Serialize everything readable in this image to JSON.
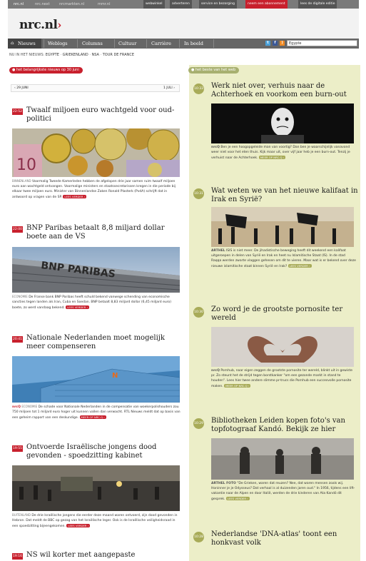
{
  "topbar": {
    "links": [
      "nrc.nl",
      "nrc.next",
      "nrcmarkten.nl",
      "mmr.nl"
    ],
    "right_links": [
      "webwinkel",
      "adverteren",
      "service en bezorging",
      "neem een abonnement",
      "lees de digitale editie"
    ]
  },
  "logo": {
    "text": "nrc",
    "suffix": ".nl",
    "arrow": "›"
  },
  "nav": {
    "items": [
      "Nieuws",
      "Weblogs",
      "Columns",
      "Cultuur",
      "Carrière",
      "In beeld"
    ],
    "search_value": "Egypte"
  },
  "subnav": {
    "label": "NU IN HET NIEUWS:",
    "items": [
      "EGYPTE",
      "GRIEKENLAND",
      "NSA",
      "TOUR DE FRANCE"
    ]
  },
  "left": {
    "section_label": "het belangrijkste nieuws op 30 juni",
    "prev_date": "‹ 29 JUNI",
    "next_date": "1 JULI ›",
    "articles": [
      {
        "time": "22:52",
        "title": "Twaalf miljoen euro wachtgeld voor oud-politici",
        "category": "BINNENLAND",
        "text": "Voormalig Tweede Kamerleden hebben de afgelopen drie jaar samen ruim twaalf miljoen euro aan wachtgeld ontvangen. Voormalige ministers en staatssecretarissen kregen in die periode bij elkaar twee miljoen euro. Minister van Binnenlandse Zaken Ronald Plasterk (PvdA) schrijft dat in antwoord op vragen van de SP.",
        "more": "LEES VERDER ›"
      },
      {
        "time": "22:00",
        "title": "BNP Paribas betaalt 8,8 miljard dollar boete aan de VS",
        "category": "ECONOMIE",
        "text": "De Franse bank BNP Paribas heeft schuld bekend vanwege schending van economische sancties tegen landen als Iran, Cuba en Soedan. BNP betaalt 8,83 miljard dollar (6,45 miljard euro) boete, zo werd vandaag bekend.",
        "more": "LEES VERDER ›"
      },
      {
        "time": "20:41",
        "title": "Nationale Nederlanden moet mogelijk meer compenseren",
        "source": "nrcQ",
        "category": "ECONOMIE",
        "text": "De schade voor Nationale Nederlanden in de compensatie van woekerpolishouders zou 750 miljoen tot 1 miljard euro hoger uit kunnen vallen dan verwacht. RTL Nieuws meldt dat op basis van een geheim rapport van een deskundige.",
        "more": "MEER OP NRC.Q ›"
      },
      {
        "time": "19:55",
        "title": "Ontvoerde Israëlische jongens dood gevonden - spoedzitting kabinet",
        "category": "BUITENLAND",
        "text": "De drie Israëlische jongens die eerder deze maand waren ontvoerd, zijn dood gevonden in Hebron. Dat meldt de BBC op gezag van het Israëlische leger. Ook is de Israëlische veiligheidsraad in een spoedzitting bijeengekomen.",
        "more": "LEES VERDER ›"
      },
      {
        "time": "19:16",
        "title": "NS wil korter met aangepaste"
      }
    ]
  },
  "right": {
    "section_label": "het beste van het web",
    "articles": [
      {
        "time": "10:33",
        "title": "Werk niet over, verhuis naar de Achterhoek en voorkom een burn-out",
        "source": "nrcQ",
        "text": "Ben je een hoogopgeleide man van voortig? Dan ben je waarschijnlijk vanavond weer niet voor het eten thuis. Kijk maar uit, over vijf jaar heb je een burn-out. Tenzij je verhuist naar de Achterhoek.",
        "more": "MEER OP NRC.Q ›"
      },
      {
        "time": "10:31",
        "title": "Wat weten we van het nieuwe kalifaat in Irak en Syrië?",
        "source": "ARTHEL",
        "text": "ISIS is niet meer. De jihadistische beweging heeft dit weekend een kalifaat uitgeroepen in delen van Syrië en Irak en heet nu Islamitische Staat (IS). In de stad Raqqa werden zwarte vlaggen gehesen om dit te vieren. Maar wat is er bekend over deze nieuwe islamitische staat binnen Syrië en Irak?",
        "more": "LEES VERDER ›"
      },
      {
        "time": "10:30",
        "title": "Zo word je de grootste pornosite ter wereld",
        "source": "nrcQ",
        "text": "Pornhub, naar eigen zeggen de grootste pornosite ter wereld, blinkt uit in gewiste pr. Zo steunt het de strijd tegen borstkanker \"om een gezonde markt in stand te houden\". Lees hier twee andere slimme pr-trucs die Pornhub een succesvolle pornosite maken.",
        "more": "MEER OP NRC.Q ›"
      },
      {
        "time": "10:29",
        "title": "Bibliotheken Leiden kopen foto's van topfotograaf Kandó. Bekijk ze hier",
        "source": "ARTHEL FOTO",
        "text": "\"De Grieken, waren dat reuzen? Nee, dat waren mensen zoals wij. Honinner je je Odysseus? Dat verhaal is al duizenden jaren oud.\" In 1956, tijdens een lift-vakantie naar de Alpen en door Italië, werden de drie kinderen van Ata Kandó dit gesprek.",
        "more": "LEES VERDER ›"
      },
      {
        "time": "10:28",
        "title": "Nederlandse 'DNA-atlas' toont een honkvast volk"
      }
    ]
  },
  "colors": {
    "accent_red": "#c8202d",
    "accent_green": "#a8ab58",
    "right_bg": "#eceec8",
    "nav_bg": "#666666"
  }
}
